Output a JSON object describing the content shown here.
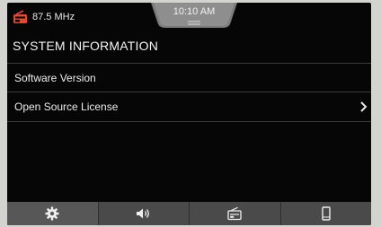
{
  "status": {
    "frequency": "87.5 MHz",
    "time": "10:10 AM",
    "source_icon": "radio-icon"
  },
  "page": {
    "title": "SYSTEM INFORMATION"
  },
  "menu": {
    "items": [
      {
        "label": "Software Version",
        "has_chevron": false
      },
      {
        "label": "Open Source License",
        "has_chevron": true
      }
    ]
  },
  "bottom_nav": {
    "tabs": [
      {
        "icon": "gear-icon",
        "active": true
      },
      {
        "icon": "speaker-icon",
        "active": false
      },
      {
        "icon": "radio-icon",
        "active": false
      },
      {
        "icon": "phone-icon",
        "active": false
      }
    ]
  },
  "colors": {
    "accent": "#e8462a",
    "background": "#060606",
    "bar": "#4a4a4a"
  }
}
